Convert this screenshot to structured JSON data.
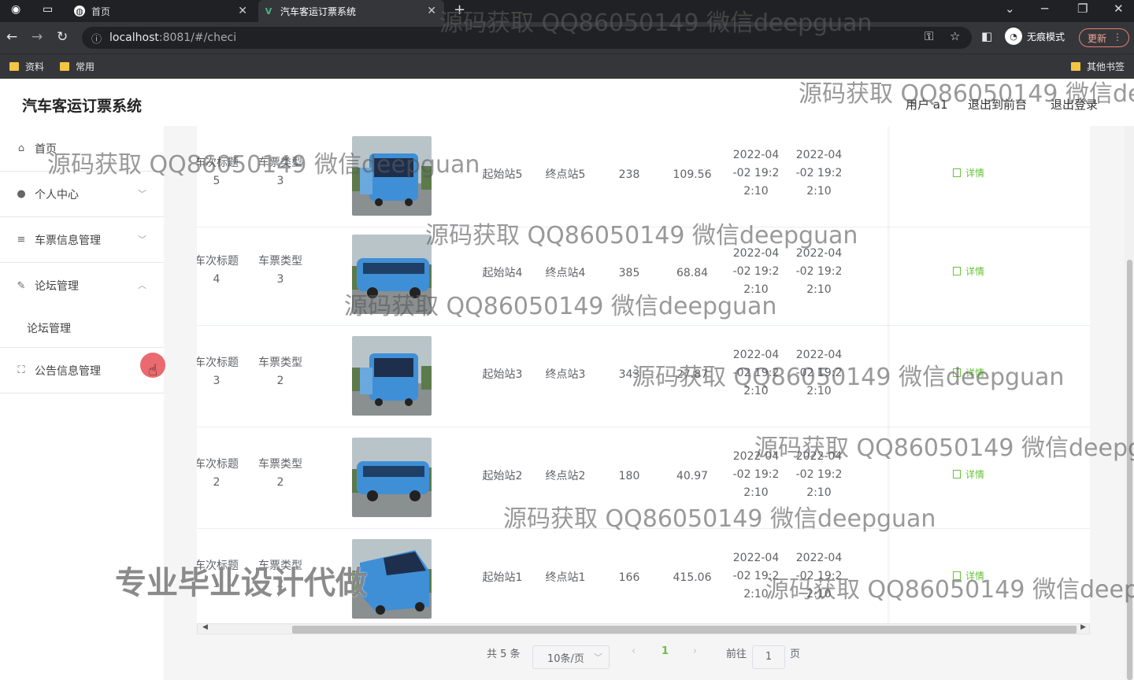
{
  "browser": {
    "tabs": [
      {
        "label": "首页",
        "active": false
      },
      {
        "label": "汽车客运订票系统",
        "active": true
      }
    ],
    "url_host": "localhost",
    "url_rest": ":8081/#/checi",
    "incognito_label": "无痕模式",
    "update_label": "更新",
    "bookmarks": [
      "资料",
      "常用"
    ],
    "other_bookmarks": "其他书签"
  },
  "app": {
    "title": "汽车客运订票系统",
    "user_label": "用户 a1",
    "back_to_front": "退出到前台",
    "logout": "退出登录"
  },
  "sidebar": {
    "items": [
      {
        "label": "首页",
        "icon": "home-icon"
      },
      {
        "label": "个人中心",
        "icon": "user-icon"
      },
      {
        "label": "车票信息管理",
        "icon": "list-icon"
      },
      {
        "label": "论坛管理",
        "icon": "edit-icon"
      },
      {
        "label": "公告信息管理",
        "icon": "expand-icon"
      }
    ],
    "sub_items": [
      {
        "label": "论坛管理"
      }
    ]
  },
  "table": {
    "rows": [
      {
        "title_label": "车次标题",
        "title": "5",
        "type_label": "车票类型",
        "type": "3",
        "start": "起始站5",
        "end": "终点站5",
        "seats": "238",
        "price": "109.56",
        "depart": [
          "2022-04",
          "-02 19:2",
          "2:10"
        ],
        "arrive": [
          "2022-04",
          "-02 19:2",
          "2:10"
        ],
        "action": "详情",
        "photo": "bus-front"
      },
      {
        "title_label": "车次标题",
        "title": "4",
        "type_label": "车票类型",
        "type": "3",
        "start": "起始站4",
        "end": "终点站4",
        "seats": "385",
        "price": "68.84",
        "depart": [
          "2022-04",
          "-02 19:2",
          "2:10"
        ],
        "arrive": [
          "2022-04",
          "-02 19:2",
          "2:10"
        ],
        "action": "详情",
        "photo": "bus-side"
      },
      {
        "title_label": "车次标题",
        "title": "3",
        "type_label": "车票类型",
        "type": "2",
        "start": "起始站3",
        "end": "终点站3",
        "seats": "343",
        "price": "27.87",
        "depart": [
          "2022-04",
          "-02 19:2",
          "2:10"
        ],
        "arrive": [
          "2022-04",
          "-02 19:2",
          "2:10"
        ],
        "action": "详情",
        "photo": "bus-front"
      },
      {
        "title_label": "车次标题",
        "title": "2",
        "type_label": "车票类型",
        "type": "2",
        "start": "起始站2",
        "end": "终点站2",
        "seats": "180",
        "price": "40.97",
        "depart": [
          "2022-04",
          "-02 19:2",
          "2:10"
        ],
        "arrive": [
          "2022-04",
          "-02 19:2",
          "2:10"
        ],
        "action": "详情",
        "photo": "bus-side"
      },
      {
        "title_label": "车次标题",
        "title": "1",
        "type_label": "车票类型",
        "type": "2",
        "start": "起始站1",
        "end": "终点站1",
        "seats": "166",
        "price": "415.06",
        "depart": [
          "2022-04",
          "-02 19:2",
          "2:10"
        ],
        "arrive": [
          "2022-04",
          "-02 19:2",
          "2:10"
        ],
        "action": "详情",
        "photo": "bus-angle"
      }
    ]
  },
  "pagination": {
    "total": "共 5 条",
    "page_size": "10条/页",
    "current_page": "1",
    "goto_label": "前往",
    "goto_value": "1",
    "page_unit": "页"
  },
  "watermarks": {
    "text_1": "源码获取 QQ86050149 微信deepguan",
    "text_2": "源码获取 QQ86050149 微信de",
    "text_3": "源码获取 QQ86050149 微信deepguan",
    "text_4": "源码获取 QQ86050149 微信deepguan",
    "text_5": "源码获取 QQ86050149 微信deepguan",
    "text_6": "源码获取 QQ86050149 微信deepguan",
    "text_7": "源码获取 QQ86050149 微信deepg",
    "text_8": "源码获取 QQ86050149 微信deepguan",
    "text_9": "源码获取 QQ86050149 微信deepg",
    "banner": "专业毕业设计代做"
  },
  "colors": {
    "accent_green": "#67c23a",
    "browser_dark": "#202124",
    "browser_toolbar": "#35363a",
    "cursor_highlight": "#e85a5f"
  }
}
